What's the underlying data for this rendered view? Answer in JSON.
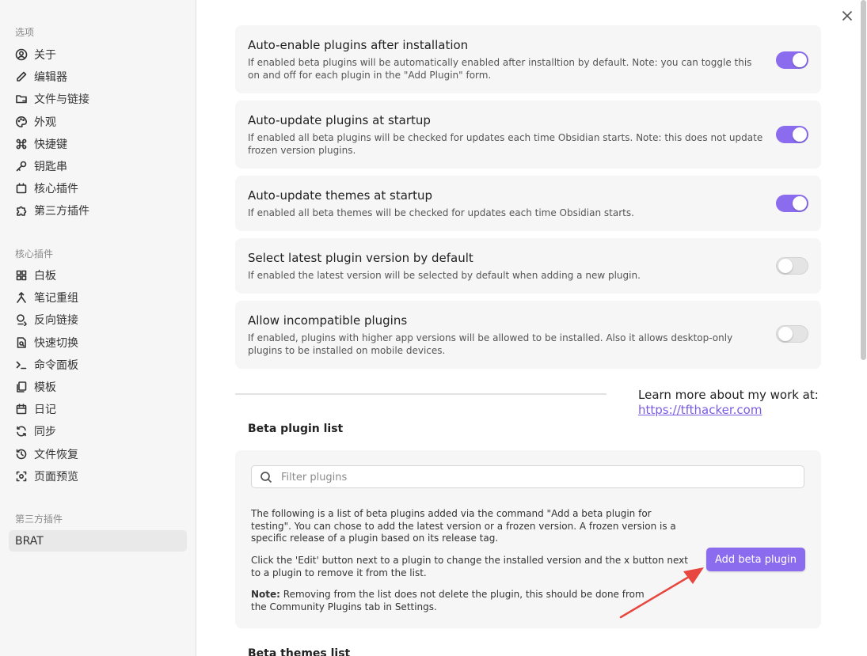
{
  "sidebar": {
    "section_options": "选项",
    "options": [
      {
        "label": "关于",
        "icon": "user-circle-icon"
      },
      {
        "label": "编辑器",
        "icon": "pencil-icon"
      },
      {
        "label": "文件与链接",
        "icon": "folder-link-icon"
      },
      {
        "label": "外观",
        "icon": "palette-icon"
      },
      {
        "label": "快捷键",
        "icon": "command-icon"
      },
      {
        "label": "钥匙串",
        "icon": "key-icon"
      },
      {
        "label": "核心插件",
        "icon": "plug-box-icon"
      },
      {
        "label": "第三方插件",
        "icon": "puzzle-icon"
      }
    ],
    "section_core": "核心插件",
    "core": [
      {
        "label": "白板",
        "icon": "grid-icon"
      },
      {
        "label": "笔记重组",
        "icon": "merge-icon"
      },
      {
        "label": "反向链接",
        "icon": "backlink-icon"
      },
      {
        "label": "快速切换",
        "icon": "quick-switch-icon"
      },
      {
        "label": "命令面板",
        "icon": "terminal-icon"
      },
      {
        "label": "模板",
        "icon": "template-icon"
      },
      {
        "label": "日记",
        "icon": "calendar-icon"
      },
      {
        "label": "同步",
        "icon": "sync-icon"
      },
      {
        "label": "文件恢复",
        "icon": "history-icon"
      },
      {
        "label": "页面预览",
        "icon": "preview-icon"
      }
    ],
    "section_third": "第三方插件",
    "third": [
      {
        "label": "BRAT"
      }
    ]
  },
  "settings": [
    {
      "title": "Auto-enable plugins after installation",
      "desc": "If enabled beta plugins will be automatically enabled after installtion by default. Note: you can toggle this on and off for each plugin in the \"Add Plugin\" form.",
      "enabled": true
    },
    {
      "title": "Auto-update plugins at startup",
      "desc": "If enabled all beta plugins will be checked for updates each time Obsidian starts. Note: this does not update frozen version plugins.",
      "enabled": true
    },
    {
      "title": "Auto-update themes at startup",
      "desc": "If enabled all beta themes will be checked for updates each time Obsidian starts.",
      "enabled": true
    },
    {
      "title": "Select latest plugin version by default",
      "desc": "If enabled the latest version will be selected by default when adding a new plugin.",
      "enabled": false
    },
    {
      "title": "Allow incompatible plugins",
      "desc": "If enabled, plugins with higher app versions will be allowed to be installed. Also it allows desktop-only plugins to be installed on mobile devices.",
      "enabled": false
    }
  ],
  "learn": {
    "text": "Learn more about my work at:",
    "link": "https://tfthacker.com"
  },
  "beta_plugin_list": {
    "heading": "Beta plugin list",
    "filter_placeholder": "Filter plugins",
    "para1": "The following is a list of beta plugins added via the command \"Add a beta plugin for testing\". You can chose to add the latest version or a frozen version. A frozen version is a specific release of a plugin based on its release tag.",
    "para2": "Click the 'Edit' button next to a plugin to change the installed version and the x button next to a plugin to remove it from the list.",
    "note_label": "Note:",
    "note_text": " Removing from the list does not delete the plugin, this should be done from the Community Plugins tab in Settings.",
    "add_button": "Add beta plugin"
  },
  "beta_themes_heading": "Beta themes list",
  "colors": {
    "accent": "#8b6cef",
    "annotation_arrow": "#e8473f"
  }
}
